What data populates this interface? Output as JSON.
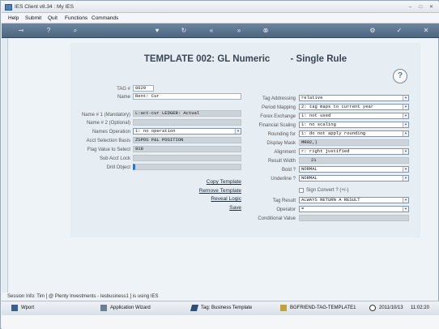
{
  "window": {
    "title": "IES Client v8.34 : My IES"
  },
  "menu": [
    "Help",
    "Submit",
    "Quit",
    "Functions",
    "Commands"
  ],
  "toolbar": {
    "icons": [
      "key-icon",
      "help-icon",
      "search-icon",
      "heart-icon",
      "refresh-icon",
      "rewind-icon",
      "fast-forward-icon",
      "close-circle-icon",
      "settings-icon",
      "check-circle-icon",
      "close-icon"
    ]
  },
  "panel": {
    "title": "TEMPLATE 002: GL Numeric",
    "subtitle": "- Single Rule",
    "help_label": "?"
  },
  "left_fields": {
    "tag_no": {
      "label": "TAG #",
      "value": "0029"
    },
    "name": {
      "label": "Name",
      "value": "Rent: Cur"
    },
    "name1": {
      "label": "Name # 1 (Mandatory)",
      "value": "L:act-cur LEDGER: Actual"
    },
    "name2": {
      "label": "Name # 2 (Optional)",
      "value": ""
    },
    "names_operation": {
      "label": "Names Operation",
      "value": "1: no operation"
    },
    "acct_selection": {
      "label": "Acct Selection Basis",
      "value": "ZSPOS P&L POSITION"
    },
    "flag_value": {
      "label": "Flag Value to Select",
      "value": "918"
    },
    "sub_acct_lock": {
      "label": "Sub Acct Lock",
      "value": ""
    },
    "drill_object": {
      "label": "Drill Object",
      "value": ""
    }
  },
  "links": {
    "copy": "Copy Template",
    "remove": "Remove Template",
    "reveal": "Reveal Logic",
    "save": "Save"
  },
  "right_fields": {
    "tag_addressing": {
      "label": "Tag Addressing",
      "value": "relative"
    },
    "period_mapping": {
      "label": "Period Mapping",
      "value": "2: tag maps to current year"
    },
    "forex_exchange": {
      "label": "Forex Exchange",
      "value": "1: not used"
    },
    "financial_scaling": {
      "label": "Financial Scaling",
      "value": "1: no scaling"
    },
    "rounding_for": {
      "label": "Rounding for",
      "value": "1: do not apply rounding"
    },
    "display_mask": {
      "label": "Display Mask",
      "value": "MR02,)"
    },
    "alignment": {
      "label": "Alignment",
      "value": "r: right justified"
    },
    "result_width": {
      "label": "Result Width",
      "value": "21"
    },
    "bold": {
      "label": "Bold ?",
      "value": "NORMAL"
    },
    "underline": {
      "label": "Underline ?",
      "value": "NORMAL"
    },
    "sign_convert": {
      "label": "Sign Convert ? (+/-)"
    },
    "tag_result": {
      "label": "Tag Result",
      "value": "ALWAYS RETURN A RESULT"
    },
    "operator": {
      "label": "Operator",
      "value": "="
    },
    "conditional_value": {
      "label": "Conditional Value",
      "value": ""
    }
  },
  "status": {
    "session_info": "Session Info: Tim [ @ Plenty Investments - Iesbusiness1 ] is using IES"
  },
  "taskbar": {
    "items": [
      "Wport",
      "Application Wizard",
      "Tag: Business Template",
      "BGFRIEND-TAG-TEMPLATE1"
    ],
    "date": "2011/10/13",
    "time": "11:02:20"
  },
  "colors": {
    "toolbar": "#5a7390",
    "panel": "#e6eef4",
    "heading": "#3b4651"
  }
}
